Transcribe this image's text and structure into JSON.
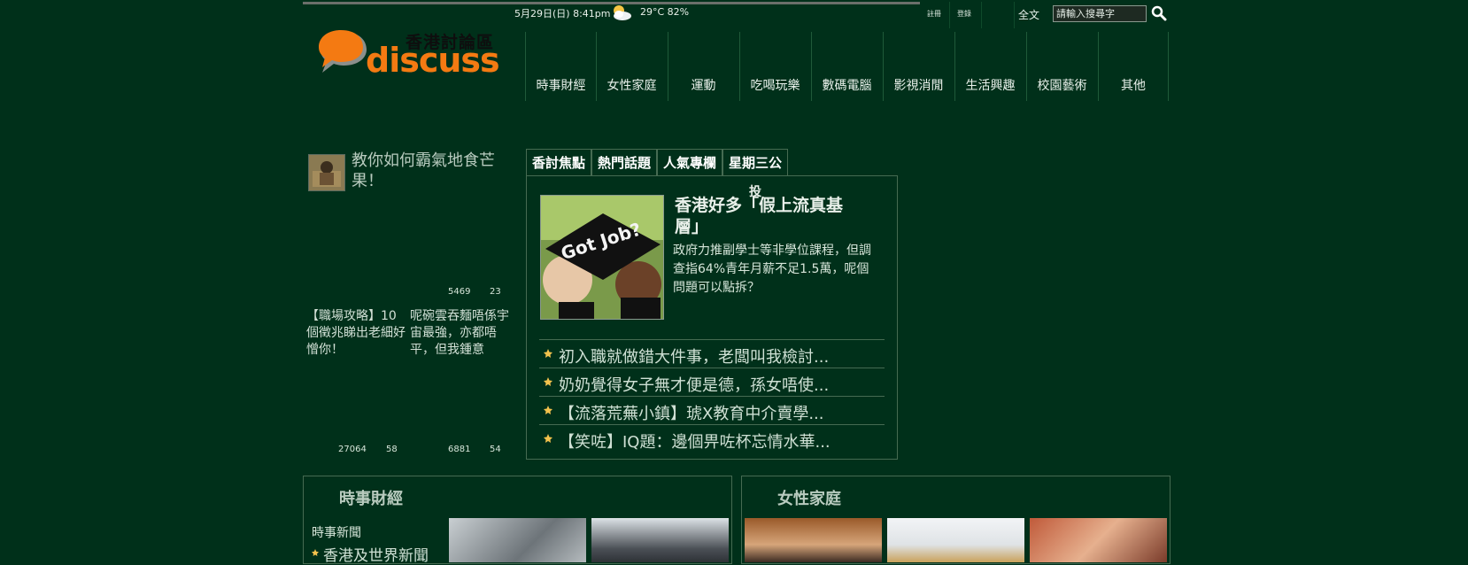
{
  "header": {
    "datetime": "5月29日(日) 8:41pm",
    "weather_temp": "29°C 82%",
    "util_links": [
      "註冊",
      "登錄"
    ],
    "fulltext_label": "全文",
    "search_placeholder": "請輸入搜尋字"
  },
  "logo": {
    "cn": "香港討論區",
    "en": "discuss"
  },
  "nav": [
    "時事財經",
    "女性家庭",
    "運動",
    "吃喝玩樂",
    "數碼電腦",
    "影視消閒",
    "生活興趣",
    "校園藝術",
    "其他"
  ],
  "left": {
    "featured_title": "教你如何霸氣地食芒果！",
    "counts_top": [
      "5469",
      "23"
    ],
    "snippets": [
      "【職場攻略】10個徵兆睇出老細好憎你！",
      "呢碗雲吞麵唔係宇宙最強，亦都唔平，但我鍾意"
    ],
    "counts_bottom": [
      "27064",
      "58",
      "6881",
      "54"
    ]
  },
  "tabs": [
    "香討焦點",
    "熱門話題",
    "人氣專欄",
    "星期三公"
  ],
  "main_story": {
    "stray_char": "投",
    "title": "香港好多「假上流真基層」",
    "desc": "政府力推副學士等非學位課程，但調查指64%青年月薪不足1.5萬，呢個問題可以點拆？",
    "image_caption": "Got Job?"
  },
  "list_items": [
    "初入職就做錯大件事，老闆叫我檢討...",
    "奶奶覺得女子無才便是德，孫女唔使...",
    "【流落荒蕪小鎮】琥X教育中介賣學...",
    "【笑咗】IQ題：邊個畀咗杯忘情水華..."
  ],
  "sections": [
    {
      "title": "時事財經",
      "sub_title": "時事新聞",
      "sub_link": "香港及世界新聞"
    },
    {
      "title": "女性家庭"
    }
  ],
  "colors": {
    "background": "#00301a",
    "accent": "#f47a12",
    "border": "#466b52"
  }
}
